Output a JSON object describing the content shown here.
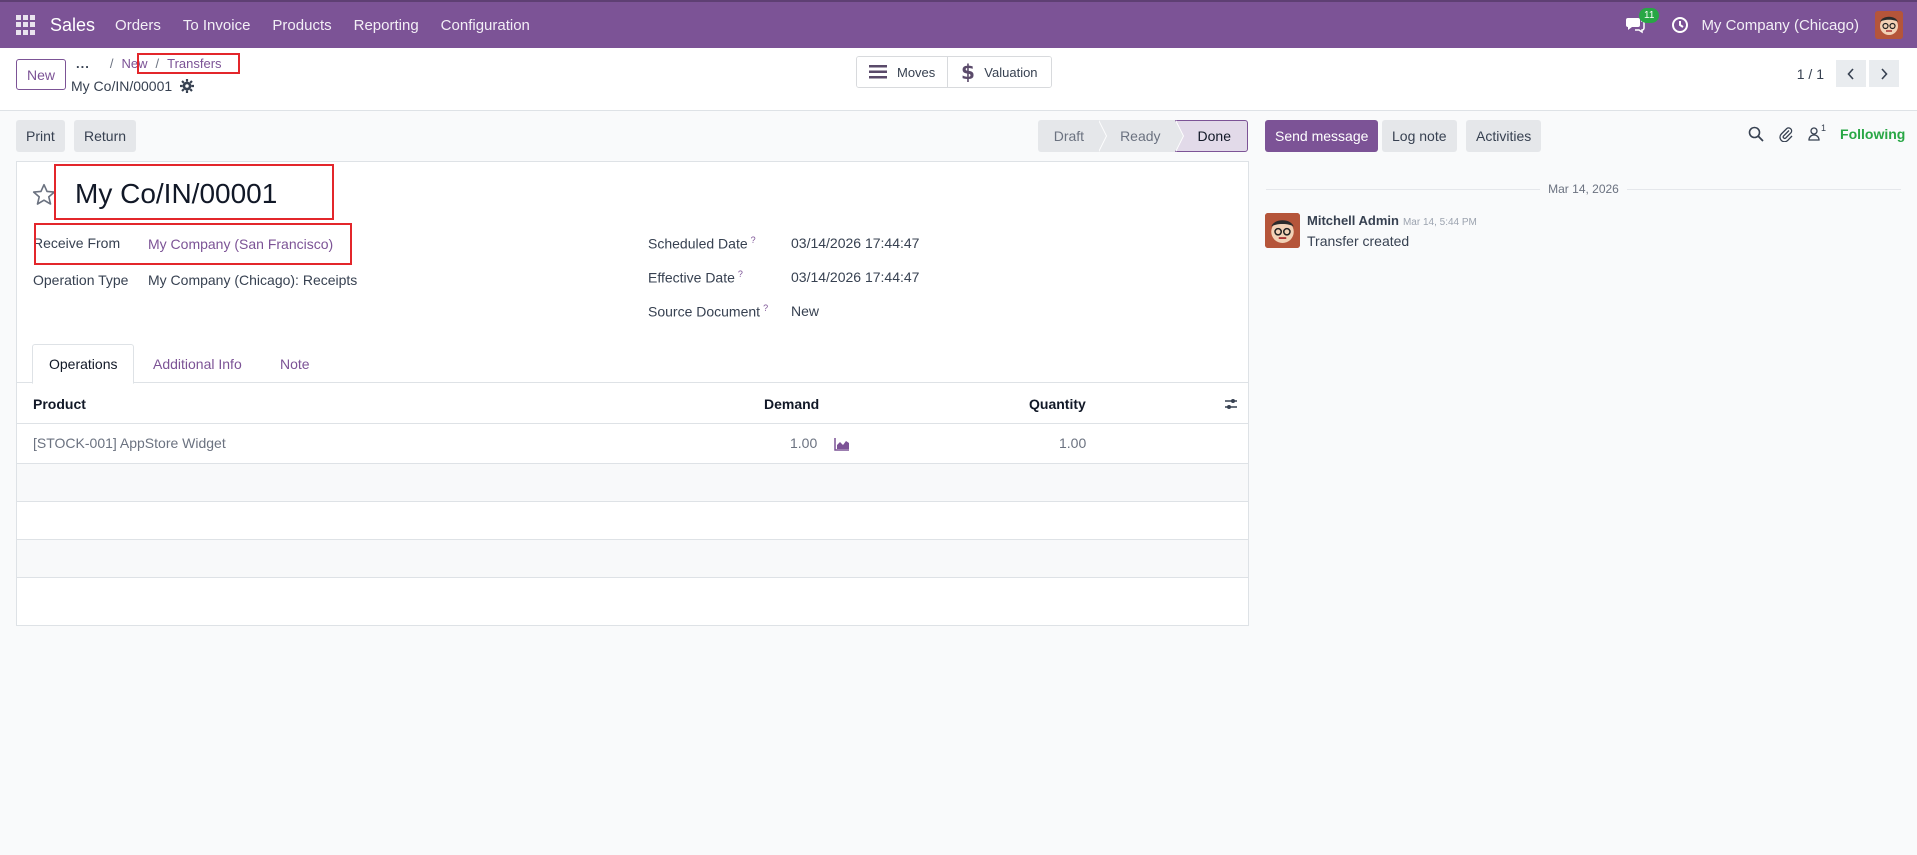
{
  "navbar": {
    "app_name": "Sales",
    "menu": [
      "Orders",
      "To Invoice",
      "Products",
      "Reporting",
      "Configuration"
    ],
    "chat_count": "11",
    "company": "My Company (Chicago)",
    "color": "#7c5396"
  },
  "control": {
    "new_label": "New",
    "breadcrumb_more": "...",
    "breadcrumb": [
      "New",
      "Transfers"
    ],
    "record_name": "My Co/IN/00001",
    "smart_buttons": {
      "moves": "Moves",
      "valuation": "Valuation"
    },
    "pager": "1 / 1"
  },
  "statusbar": {
    "print_label": "Print",
    "return_label": "Return",
    "stages": [
      "Draft",
      "Ready",
      "Done"
    ],
    "active_stage": "Done"
  },
  "form": {
    "title": "My Co/IN/00001",
    "receive_from_label": "Receive From",
    "receive_from_value": "My Company (San Francisco)",
    "operation_type_label": "Operation Type",
    "operation_type_value": "My Company (Chicago): Receipts",
    "scheduled_date_label": "Scheduled Date",
    "scheduled_date_value": "03/14/2026 17:44:47",
    "effective_date_label": "Effective Date",
    "effective_date_value": "03/14/2026 17:44:47",
    "source_document_label": "Source Document",
    "source_document_value": "New",
    "help_mark": "?"
  },
  "tabs": [
    "Operations",
    "Additional Info",
    "Note"
  ],
  "operations_table": {
    "headers": {
      "product": "Product",
      "demand": "Demand",
      "quantity": "Quantity"
    },
    "rows": [
      {
        "product": "[STOCK-001] AppStore Widget",
        "demand": "1.00",
        "quantity": "1.00"
      }
    ]
  },
  "chatter": {
    "send_message": "Send message",
    "log_note": "Log note",
    "activities": "Activities",
    "followers_count": "1",
    "following": "Following",
    "date_separator": "Mar 14, 2026",
    "messages": [
      {
        "author": "Mitchell Admin",
        "time": "Mar 14, 5:44 PM",
        "body": "Transfer created"
      }
    ]
  }
}
